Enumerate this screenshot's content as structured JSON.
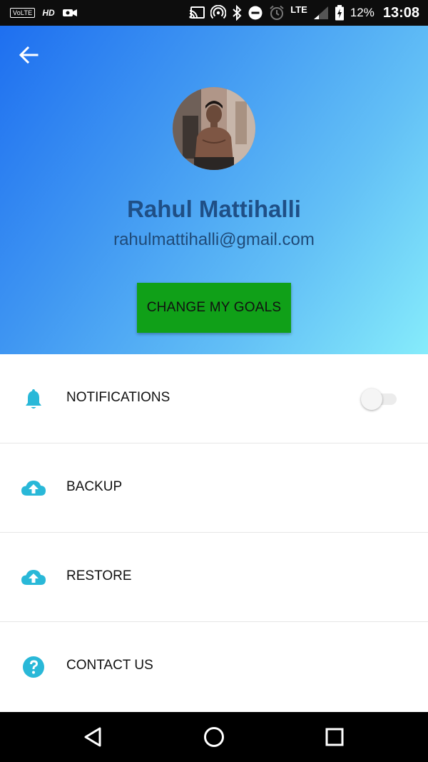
{
  "status_bar": {
    "volte": "VoLTE",
    "hd": "HD",
    "lte": "LTE",
    "battery_percent": "12%",
    "time": "13:08",
    "icons": [
      "video-camera-icon",
      "cast-icon",
      "hotspot-icon",
      "bluetooth-icon",
      "do-not-disturb-icon",
      "alarm-icon",
      "signal-icon",
      "battery-icon"
    ]
  },
  "header": {
    "back_icon": "arrow-left-icon",
    "user_name": "Rahul Mattihalli",
    "user_email": "rahulmattihalli@gmail.com",
    "goals_button_label": "CHANGE MY GOALS",
    "goals_button_color": "#10a018",
    "gradient": [
      "#1e6ff0",
      "#86ecfb"
    ]
  },
  "menu": {
    "accent_color": "#29b8d8",
    "items": [
      {
        "label": "NOTIFICATIONS",
        "icon": "bell-icon",
        "toggle": false
      },
      {
        "label": "BACKUP",
        "icon": "cloud-upload-icon"
      },
      {
        "label": "RESTORE",
        "icon": "cloud-upload-icon"
      },
      {
        "label": "CONTACT US",
        "icon": "help-circle-icon"
      }
    ]
  },
  "nav_bar": {
    "icons": [
      "back-triangle-icon",
      "home-circle-icon",
      "recents-square-icon"
    ]
  }
}
